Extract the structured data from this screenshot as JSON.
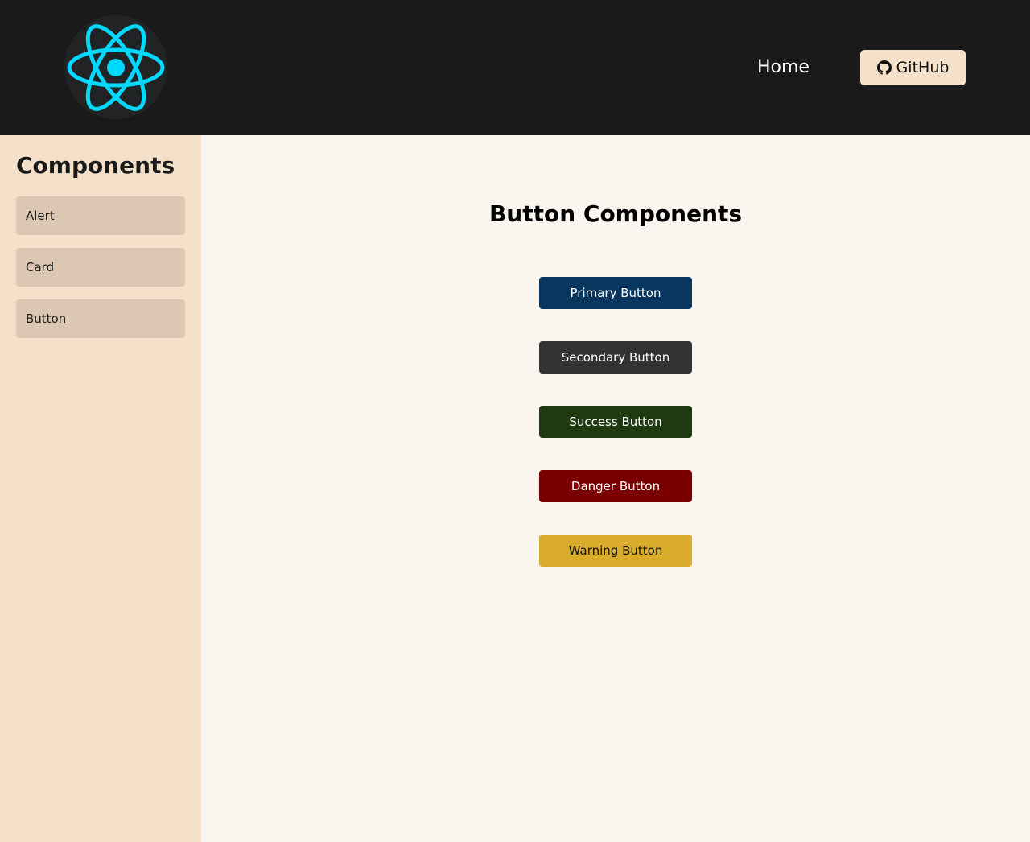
{
  "header": {
    "logo_icon": "react-atom-icon",
    "nav_home": "Home",
    "github_label": "GitHub",
    "github_icon": "github-icon"
  },
  "sidebar": {
    "title": "Components",
    "items": [
      {
        "label": "Alert"
      },
      {
        "label": "Card"
      },
      {
        "label": "Button"
      }
    ]
  },
  "main": {
    "title": "Button Components",
    "buttons": [
      {
        "label": "Primary Button",
        "background": "#08365f",
        "color": "#ffffff"
      },
      {
        "label": "Secondary Button",
        "background": "#333333",
        "color": "#ffffff"
      },
      {
        "label": "Success Button",
        "background": "#1f3a10",
        "color": "#ffffff"
      },
      {
        "label": "Danger Button",
        "background": "#7a0000",
        "color": "#ffffff"
      },
      {
        "label": "Warning Button",
        "background": "#d9ad2b",
        "color": "#111111"
      }
    ]
  },
  "colors": {
    "header_bg": "#1a1a1a",
    "sidebar_bg": "#f4e0c8",
    "sidebar_item_bg": "#dbc7b2",
    "main_bg": "#faf6ef",
    "github_btn_bg": "#f5e1c9",
    "react_accent": "#00d8ff"
  }
}
